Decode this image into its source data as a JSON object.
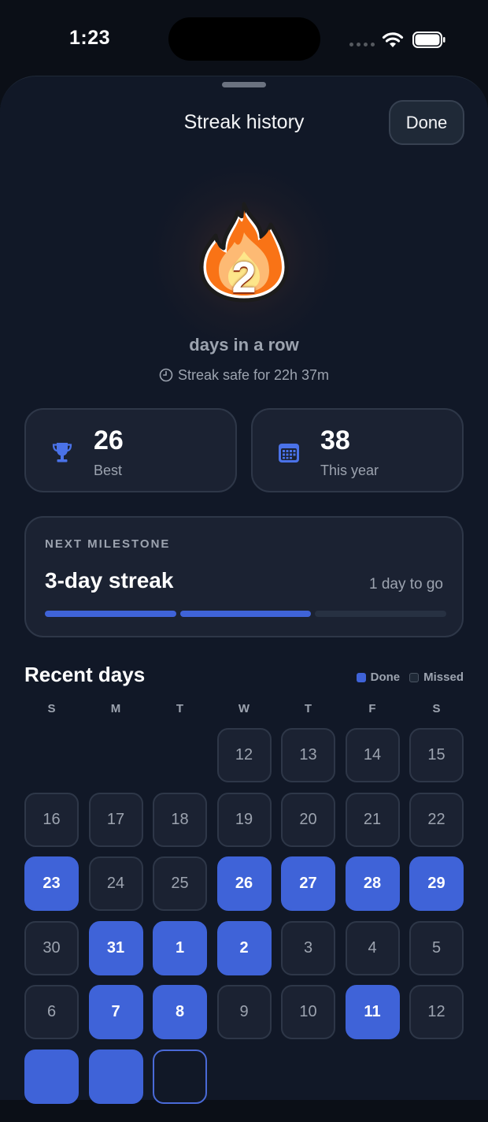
{
  "status_bar": {
    "time": "1:23"
  },
  "sheet": {
    "title": "Streak history",
    "done_label": "Done"
  },
  "streak": {
    "count": "2",
    "caption": "days in a row",
    "safe_text": "Streak safe for 22h 37m"
  },
  "stats": [
    {
      "value": "26",
      "label": "Best",
      "icon": "trophy-icon"
    },
    {
      "value": "38",
      "label": "This year",
      "icon": "calendar-icon"
    }
  ],
  "milestone": {
    "kicker": "NEXT MILESTONE",
    "title": "3-day streak",
    "remaining": "1 day to go",
    "progress_segments_filled": 2,
    "progress_segments_total": 3
  },
  "recent": {
    "title": "Recent days",
    "legend": {
      "done": "Done",
      "missed": "Missed"
    },
    "weekdays": [
      "S",
      "M",
      "T",
      "W",
      "T",
      "F",
      "S"
    ],
    "leading_blanks": 3,
    "days": [
      {
        "label": "12",
        "status": "missed"
      },
      {
        "label": "13",
        "status": "missed"
      },
      {
        "label": "14",
        "status": "missed"
      },
      {
        "label": "15",
        "status": "missed"
      },
      {
        "label": "16",
        "status": "missed"
      },
      {
        "label": "17",
        "status": "missed"
      },
      {
        "label": "18",
        "status": "missed"
      },
      {
        "label": "19",
        "status": "missed"
      },
      {
        "label": "20",
        "status": "missed"
      },
      {
        "label": "21",
        "status": "missed"
      },
      {
        "label": "22",
        "status": "missed"
      },
      {
        "label": "23",
        "status": "done"
      },
      {
        "label": "24",
        "status": "missed"
      },
      {
        "label": "25",
        "status": "missed"
      },
      {
        "label": "26",
        "status": "done"
      },
      {
        "label": "27",
        "status": "done"
      },
      {
        "label": "28",
        "status": "done"
      },
      {
        "label": "29",
        "status": "done"
      },
      {
        "label": "30",
        "status": "missed"
      },
      {
        "label": "31",
        "status": "done"
      },
      {
        "label": "1",
        "status": "done"
      },
      {
        "label": "2",
        "status": "done"
      },
      {
        "label": "3",
        "status": "missed"
      },
      {
        "label": "4",
        "status": "missed"
      },
      {
        "label": "5",
        "status": "missed"
      },
      {
        "label": "6",
        "status": "missed"
      },
      {
        "label": "7",
        "status": "done"
      },
      {
        "label": "8",
        "status": "done"
      },
      {
        "label": "9",
        "status": "missed"
      },
      {
        "label": "10",
        "status": "missed"
      },
      {
        "label": "11",
        "status": "done"
      },
      {
        "label": "12",
        "status": "missed"
      },
      {
        "label": "",
        "status": "done"
      },
      {
        "label": "",
        "status": "done"
      },
      {
        "label": "",
        "status": "today"
      }
    ]
  },
  "colors": {
    "accent": "#3f63d8",
    "background": "#111827",
    "card": "#1b2232",
    "muted_text": "#9ca3af"
  }
}
